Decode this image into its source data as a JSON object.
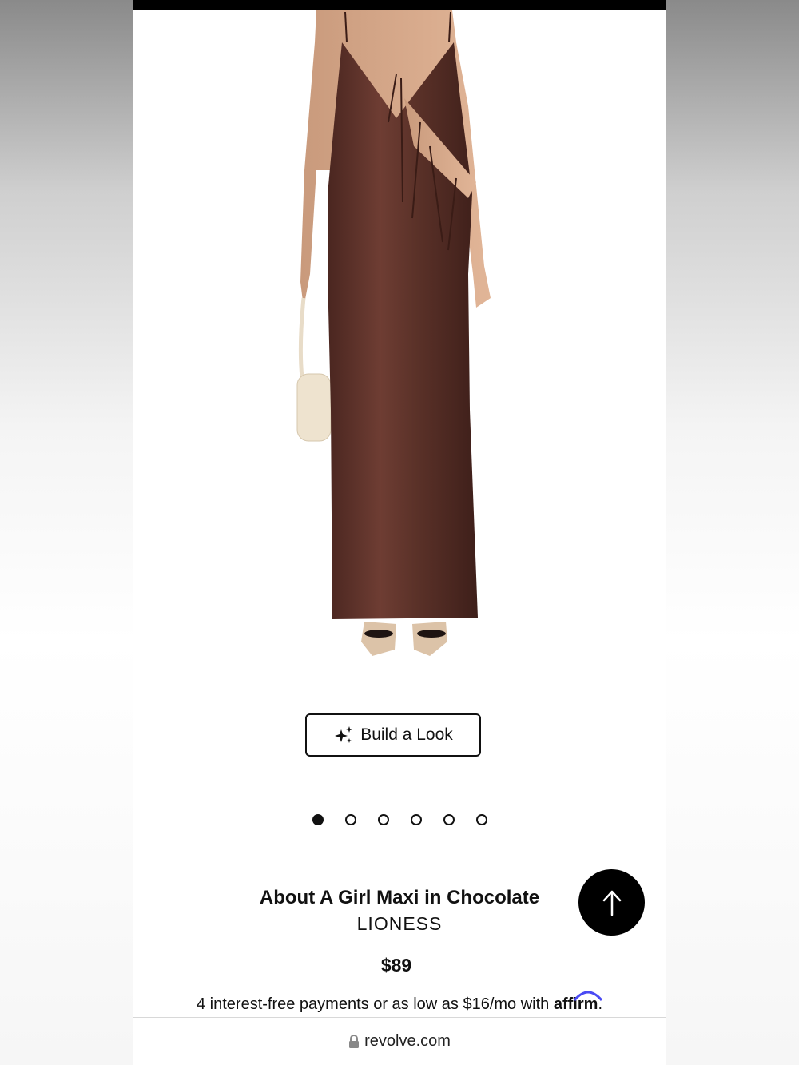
{
  "product": {
    "title": "About A Girl Maxi in Chocolate",
    "brand": "LIONESS",
    "price": "$89",
    "image_icon": "dress-product-image",
    "dress_color": "#5a3128"
  },
  "build_look": {
    "label": "Build a Look",
    "icon": "sparkle-icon"
  },
  "carousel": {
    "count": 6,
    "active_index": 0
  },
  "financing": {
    "text": "4 interest-free payments or as low as $16/mo with ",
    "provider": "affirm",
    "suffix": ".",
    "accent": "#4a4af4"
  },
  "scroll_top": {
    "icon": "arrow-up-icon"
  },
  "browser": {
    "url": "revolve.com",
    "lock_icon": "lock-icon"
  }
}
